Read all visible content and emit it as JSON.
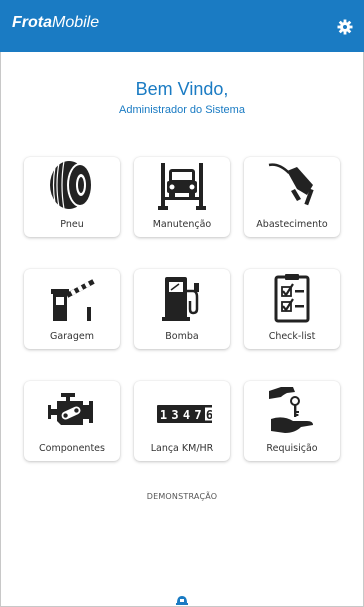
{
  "app": {
    "brand_bold": "Frota",
    "brand_light": "Mobile"
  },
  "welcome": {
    "title": "Bem Vindo,",
    "subtitle": "Administrador do Sistema"
  },
  "menu": [
    {
      "label": "Pneu",
      "icon": "tire-icon"
    },
    {
      "label": "Manutenção",
      "icon": "car-lift-icon"
    },
    {
      "label": "Abastecimento",
      "icon": "fuel-nozzle-icon"
    },
    {
      "label": "Garagem",
      "icon": "garage-barrier-icon"
    },
    {
      "label": "Bomba",
      "icon": "fuel-pump-icon"
    },
    {
      "label": "Check-list",
      "icon": "checklist-icon"
    },
    {
      "label": "Componentes",
      "icon": "engine-icon"
    },
    {
      "label": "Lança KM/HR",
      "icon": "odometer-icon"
    },
    {
      "label": "Requisição",
      "icon": "hand-key-icon"
    }
  ],
  "odometer": {
    "digits": "13476"
  },
  "footer": {
    "demo_label": "DEMONSTRAÇÃO"
  },
  "colors": {
    "primary": "#1a7bc3",
    "icon": "#222222"
  }
}
